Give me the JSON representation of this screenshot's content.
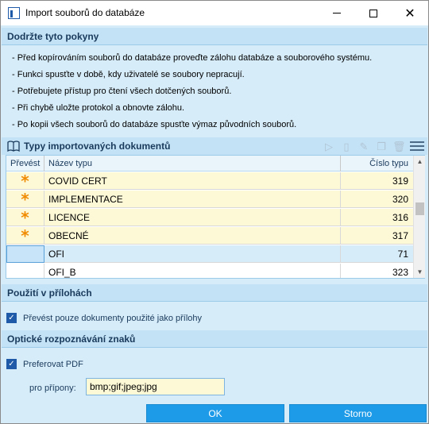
{
  "window": {
    "title": "Import souborů do databáze"
  },
  "instructions": {
    "header": "Dodržte tyto pokyny",
    "lines": [
      "- Před kopírováním souborů do databáze proveďte zálohu databáze a souborového systému.",
      "- Funkci spusťte v době, kdy uživatelé se soubory nepracují.",
      "- Potřebujete přístup pro čtení všech dotčených souborů.",
      "- Při chybě uložte protokol a obnovte zálohu.",
      "- Po kopii všech souborů do databáze spusťte výmaz původních souborů."
    ]
  },
  "doc_types": {
    "header": "Typy importovaných dokumentů",
    "columns": {
      "prevest": "Převést",
      "name": "Název typu",
      "number": "Číslo typu"
    },
    "rows": [
      {
        "prevest": "*",
        "name": "COVID CERT",
        "number": "319"
      },
      {
        "prevest": "*",
        "name": "IMPLEMENTACE",
        "number": "320"
      },
      {
        "prevest": "*",
        "name": "LICENCE",
        "number": "316"
      },
      {
        "prevest": "*",
        "name": "OBECNÉ",
        "number": "317"
      },
      {
        "prevest": "",
        "name": "OFI",
        "number": "71"
      },
      {
        "prevest": "",
        "name": "OFI_B",
        "number": "323"
      }
    ]
  },
  "attachments": {
    "header": "Použití v přílohách",
    "checkbox_label": "Převést pouze dokumenty použité jako přílohy",
    "checked": true
  },
  "ocr": {
    "header": "Optické rozpoznávání znaků",
    "checkbox_label": "Preferovat PDF",
    "checked": true,
    "ext_label": "pro přípony:",
    "ext_value": "bmp;gif;jpeg;jpg"
  },
  "buttons": {
    "ok": "OK",
    "cancel": "Storno"
  },
  "colors": {
    "accent": "#1e9be8",
    "panel": "#d6ecf9",
    "highlight_row": "#fdf8d6",
    "star": "#f08a00"
  }
}
